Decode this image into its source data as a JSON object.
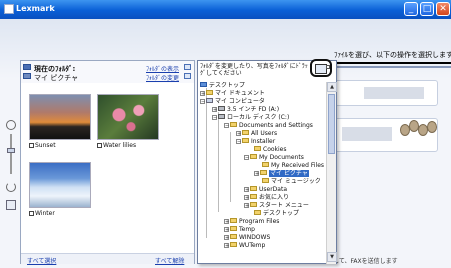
{
  "window": {
    "title": "Lexmark",
    "minimize": "_",
    "maximize": "□",
    "close": "✕"
  },
  "instruction": "ﾌｧｲﾙを選び、以下の操作を選択します",
  "panel": {
    "current_folder_label": "現在のﾌｫﾙﾀﾞ:",
    "current_folder_name": "マイ ピクチャ",
    "link_list": "ﾌｫﾙﾀﾞの表示",
    "link_thumbs": "ﾌｫﾙﾀﾞの変更",
    "photos": [
      {
        "name": "Sunset"
      },
      {
        "name": "Water lilies"
      },
      {
        "name": "Winter"
      }
    ],
    "select_all": "すべて選択",
    "clear_all": "すべて解除"
  },
  "popup": {
    "hint": "ﾌｫﾙﾀﾞを変更したり、写真をﾌｫﾙﾀﾞにﾄﾞﾗｯｸﾞしてください",
    "tree": [
      {
        "label": "デスクトップ",
        "icon": "desktop-icon"
      },
      {
        "label": "マイ ドキュメント",
        "icon": "folder-icon"
      },
      {
        "label": "マイ コンピュータ",
        "icon": "computer-icon"
      },
      {
        "label": "3.5 インチ FD (A:)",
        "icon": "floppy-icon"
      },
      {
        "label": "ローカル ディスク (C:)",
        "icon": "drive-icon"
      },
      {
        "label": "Documents and Settings",
        "icon": "folder-icon"
      },
      {
        "label": "All Users",
        "icon": "folder-icon"
      },
      {
        "label": "Installer",
        "icon": "folder-icon"
      },
      {
        "label": "Cookies",
        "icon": "folder-icon"
      },
      {
        "label": "My Documents",
        "icon": "folder-icon"
      },
      {
        "label": "My Received Files",
        "icon": "folder-icon"
      },
      {
        "label": "マイ ピクチャ",
        "icon": "folder-icon"
      },
      {
        "label": "マイ ミュージック",
        "icon": "folder-icon"
      },
      {
        "label": "UserData",
        "icon": "folder-icon"
      },
      {
        "label": "お気に入り",
        "icon": "folder-icon"
      },
      {
        "label": "スタート メニュー",
        "icon": "folder-icon"
      },
      {
        "label": "デスクトップ",
        "icon": "folder-icon"
      },
      {
        "label": "Program Files",
        "icon": "folder-icon"
      },
      {
        "label": "Temp",
        "icon": "folder-icon"
      },
      {
        "label": "WINDOWS",
        "icon": "folder-icon"
      },
      {
        "label": "WUTemp",
        "icon": "folder-icon"
      }
    ]
  },
  "status_text": "選択したﾌｧｲﾙを添付して、FAXを送信します"
}
